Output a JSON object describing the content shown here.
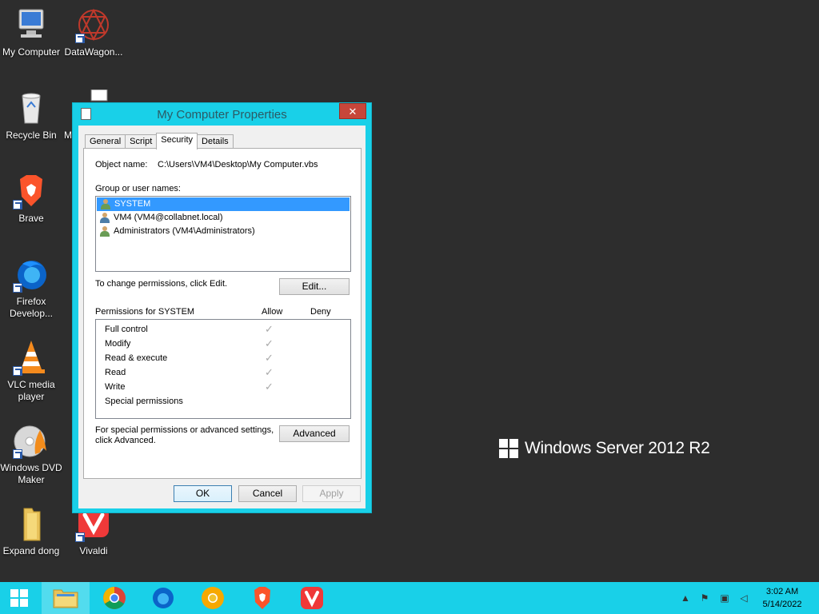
{
  "desktop": {
    "icons": [
      {
        "label": "My Computer"
      },
      {
        "label": "DataWagon..."
      },
      {
        "label": "Recycle Bin"
      },
      {
        "label": "M"
      },
      {
        "label": "Brave"
      },
      {
        "label": "Firefox Develop..."
      },
      {
        "label": "VLC media player"
      },
      {
        "label": "Windows DVD Maker"
      },
      {
        "label": "Expand dong"
      },
      {
        "label": "Vivaldi"
      }
    ],
    "watermark": "Windows Server 2012 R2"
  },
  "dialog": {
    "title": "My Computer Properties",
    "close_label": "✕",
    "tabs": [
      {
        "label": "General"
      },
      {
        "label": "Script"
      },
      {
        "label": "Security",
        "active": true
      },
      {
        "label": "Details"
      }
    ],
    "object_name_label": "Object name:",
    "object_name_value": "C:\\Users\\VM4\\Desktop\\My Computer.vbs",
    "group_label": "Group or user names:",
    "users": [
      {
        "name": "SYSTEM",
        "selected": true,
        "icon": "group-icon"
      },
      {
        "name": "VM4 (VM4@collabnet.local)",
        "selected": false,
        "icon": "user-icon"
      },
      {
        "name": "Administrators (VM4\\Administrators)",
        "selected": false,
        "icon": "group-icon"
      }
    ],
    "change_text": "To change permissions, click Edit.",
    "edit_button": "Edit...",
    "permissions_for": "Permissions for SYSTEM",
    "allow_header": "Allow",
    "deny_header": "Deny",
    "permissions": [
      {
        "name": "Full control",
        "allow": true,
        "deny": false
      },
      {
        "name": "Modify",
        "allow": true,
        "deny": false
      },
      {
        "name": "Read & execute",
        "allow": true,
        "deny": false
      },
      {
        "name": "Read",
        "allow": true,
        "deny": false
      },
      {
        "name": "Write",
        "allow": true,
        "deny": false
      },
      {
        "name": "Special permissions",
        "allow": false,
        "deny": false
      }
    ],
    "special_text_1": "For special permissions or advanced settings,",
    "special_text_2": "click Advanced.",
    "advanced_button": "Advanced",
    "ok_button": "OK",
    "cancel_button": "Cancel",
    "apply_button": "Apply"
  },
  "taskbar": {
    "apps": [
      "File Explorer",
      "Chrome",
      "Firefox Developer",
      "Chrome Canary",
      "Brave",
      "Vivaldi"
    ],
    "time": "3:02 AM",
    "date": "5/14/2022",
    "tray_arrow": "▲"
  }
}
